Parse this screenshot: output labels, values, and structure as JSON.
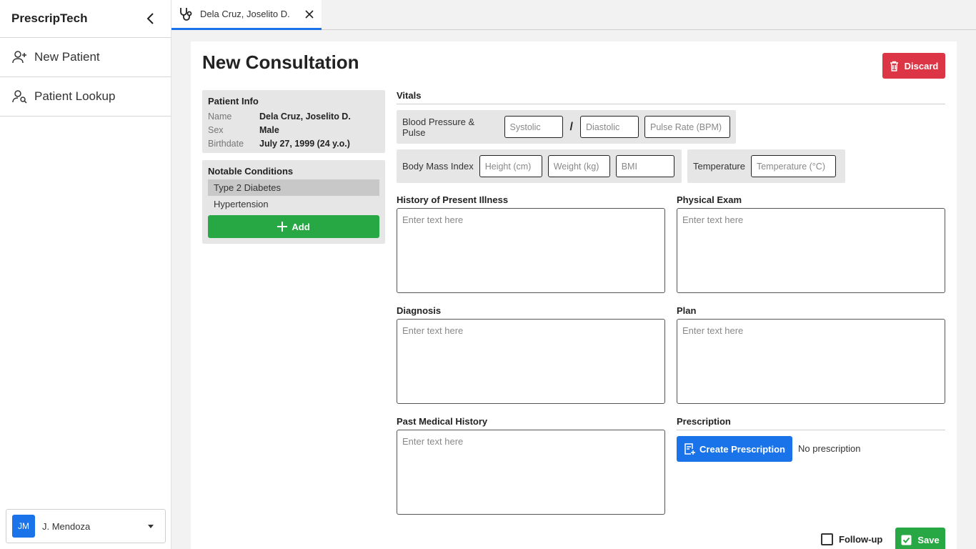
{
  "sidebar": {
    "brand": "PrescripTech",
    "collapse_icon": "chevron-left-icon",
    "items": [
      {
        "label": "New Patient",
        "icon": "user-plus-icon"
      },
      {
        "label": "Patient Lookup",
        "icon": "user-search-icon"
      }
    ],
    "user": {
      "initials": "JM",
      "name": "J. Mendoza"
    }
  },
  "tabs": [
    {
      "label": "Dela Cruz, Joselito D.",
      "icon": "stethoscope-icon",
      "active": true
    }
  ],
  "page": {
    "title": "New Consultation",
    "discard_label": "Discard"
  },
  "patient_info": {
    "title": "Patient Info",
    "rows": [
      {
        "key": "Name",
        "value": "Dela Cruz, Joselito D."
      },
      {
        "key": "Sex",
        "value": "Male"
      },
      {
        "key": "Birthdate",
        "value": "July 27, 1999 (24 y.o.)"
      }
    ]
  },
  "conditions": {
    "title": "Notable Conditions",
    "items": [
      "Type 2 Diabetes",
      "Hypertension"
    ],
    "add_label": "Add"
  },
  "vitals": {
    "title": "Vitals",
    "bp_label": "Blood Pressure & Pulse",
    "systolic_placeholder": "Systolic",
    "separator": "/",
    "diastolic_placeholder": "Diastolic",
    "pulse_placeholder": "Pulse Rate (BPM)",
    "bmi_label": "Body Mass Index",
    "height_placeholder": "Height (cm)",
    "weight_placeholder": "Weight (kg)",
    "bmi_placeholder": "BMI",
    "temp_label": "Temperature",
    "temp_placeholder": "Temperature (°C)"
  },
  "fields": {
    "placeholder": "Enter text here",
    "hpi_label": "History of Present Illness",
    "pe_label": "Physical Exam",
    "diagnosis_label": "Diagnosis",
    "plan_label": "Plan",
    "pmh_label": "Past Medical History"
  },
  "prescription": {
    "title": "Prescription",
    "button_label": "Create Prescription",
    "status": "No prescription"
  },
  "footer": {
    "followup_label": "Follow-up",
    "followup_checked": false,
    "save_label": "Save"
  },
  "colors": {
    "primary": "#1a73e8",
    "danger": "#dc3545",
    "success": "#28a745"
  }
}
